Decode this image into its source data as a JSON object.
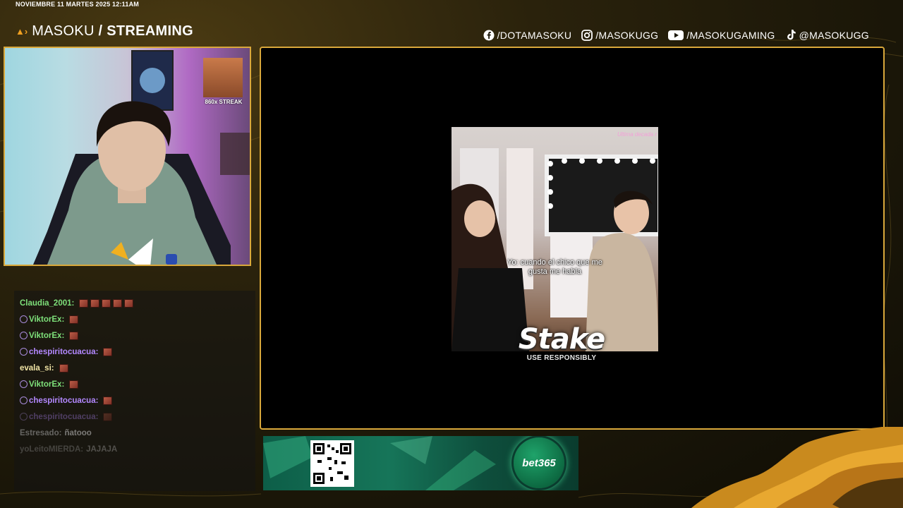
{
  "header": {
    "date_time": "NOVIEMBRE 11 MARTES 2025 12:11AM",
    "brand_prefix": "MASOKU",
    "brand_separator": "/",
    "brand_suffix": "STREAMING"
  },
  "socials": [
    {
      "icon": "facebook-icon",
      "label": "/DOTAMASOKU"
    },
    {
      "icon": "instagram-icon",
      "label": "/MASOKUGG"
    },
    {
      "icon": "youtube-icon",
      "label": "/MASOKUGAMING"
    },
    {
      "icon": "tiktok-icon",
      "label": "@MASOKUGG"
    }
  ],
  "webcam": {
    "streak_label": "860x STREAK"
  },
  "video": {
    "top_right_text": "Ultima decada r",
    "caption_line1": "Yo: cuando el chico que me",
    "caption_line2": "gusta me habla"
  },
  "stake": {
    "logo": "Stake",
    "tagline": "USE RESPONSIBLY"
  },
  "chat": {
    "messages": [
      {
        "user": "Claudia_2001:",
        "user_color": "#7ee07a",
        "badge": false,
        "emotes": 5,
        "text": "",
        "opacity": 1
      },
      {
        "user": "ViktorEx:",
        "user_color": "#7ee07a",
        "badge": true,
        "emotes": 1,
        "text": "",
        "opacity": 1
      },
      {
        "user": "ViktorEx:",
        "user_color": "#7ee07a",
        "badge": true,
        "emotes": 1,
        "text": "",
        "opacity": 1
      },
      {
        "user": "chespiritocuacua:",
        "user_color": "#b388ff",
        "badge": true,
        "emotes": 1,
        "text": "",
        "opacity": 1
      },
      {
        "user": "evala_si:",
        "user_color": "#f2e6a6",
        "badge": false,
        "emotes": 1,
        "text": "",
        "opacity": 1
      },
      {
        "user": "ViktorEx:",
        "user_color": "#7ee07a",
        "badge": true,
        "emotes": 1,
        "text": "",
        "opacity": 1
      },
      {
        "user": "chespiritocuacua:",
        "user_color": "#b388ff",
        "badge": true,
        "emotes": 1,
        "text": "",
        "opacity": 1
      },
      {
        "user": "chespiritocuacua:",
        "user_color": "#b388ff",
        "badge": true,
        "emotes": 1,
        "text": "",
        "opacity": 0.35
      },
      {
        "user": "Estresado:",
        "user_color": "#9a9a9a",
        "badge": false,
        "emotes": 0,
        "text": "ñatooo",
        "opacity": 0.6
      },
      {
        "user": "yoLeitoMIERDA:",
        "user_color": "#9a9a9a",
        "badge": false,
        "emotes": 0,
        "text": "JAJAJA",
        "opacity": 0.35
      }
    ]
  },
  "ad": {
    "brand": "bet365"
  },
  "colors": {
    "frame_gold": "#d9a83b",
    "accent_orange": "#f0a020"
  }
}
